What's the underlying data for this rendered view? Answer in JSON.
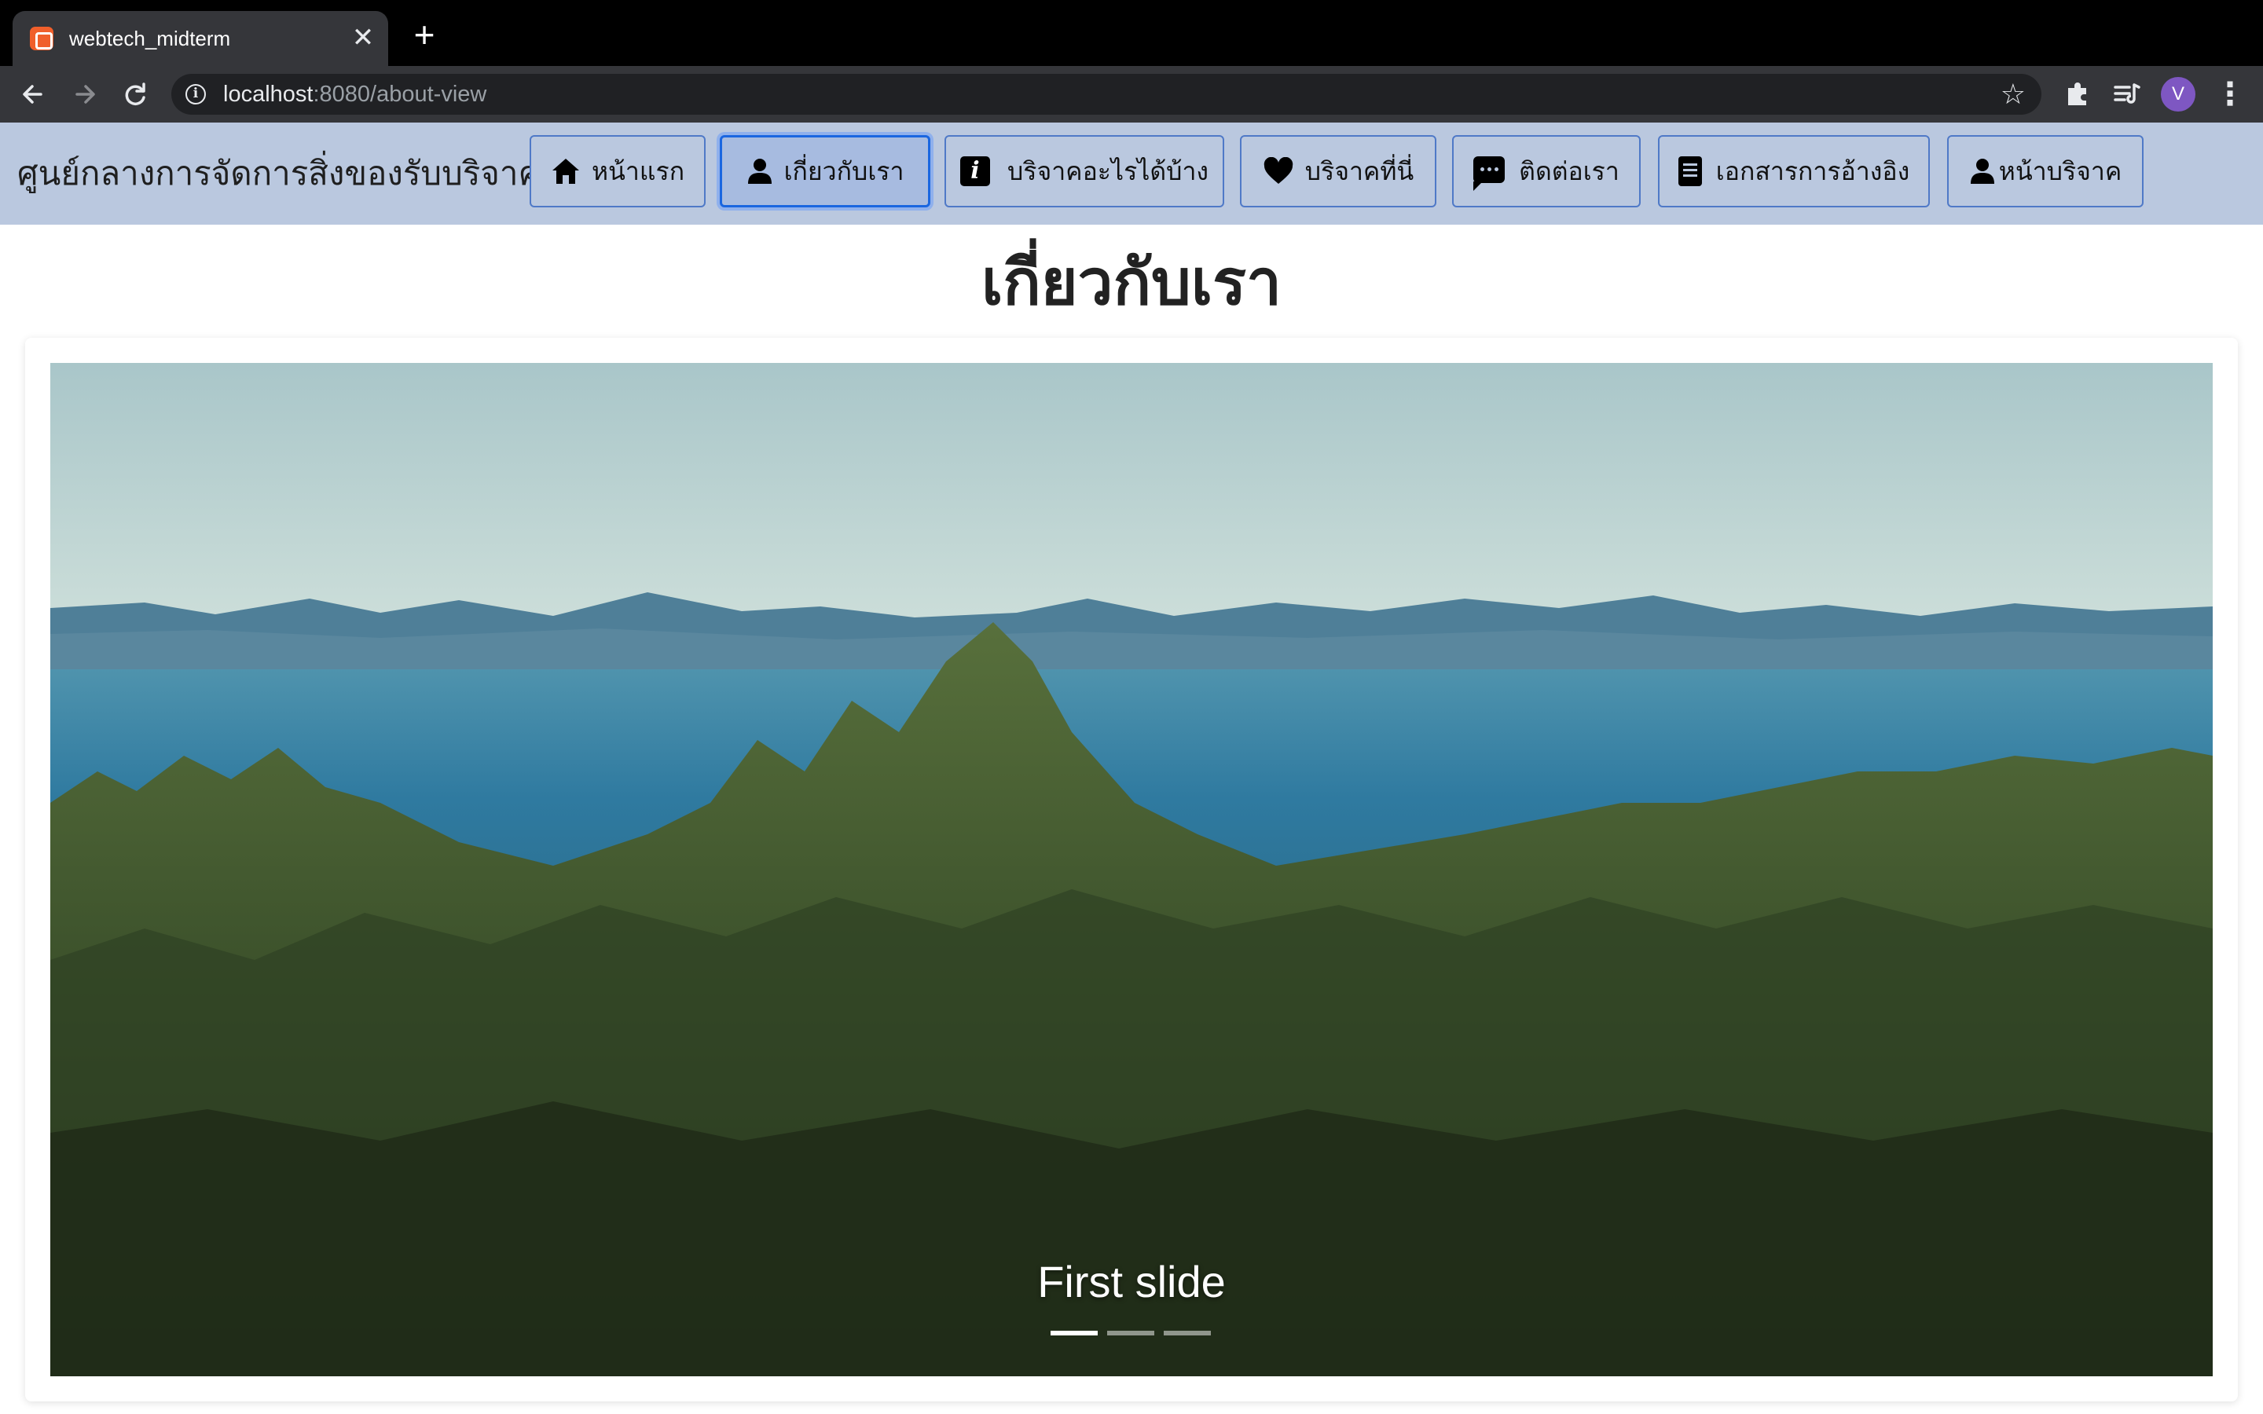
{
  "browser": {
    "tab_title": "webtech_midterm",
    "tab_close": "✕",
    "new_tab": "+",
    "url_host": "localhost",
    "url_rest": ":8080/about-view",
    "profile_initial": "V",
    "icons": [
      "back-icon",
      "forward-icon",
      "reload-icon",
      "info-icon",
      "star-icon",
      "puzzle-icon",
      "media-queue-icon",
      "more-icon"
    ]
  },
  "site": {
    "brand": "ศูนย์กลางการจัดการสิ่งของรับบริจาค",
    "nav": [
      {
        "label": "หน้าแรก",
        "icon": "home-icon",
        "active": false
      },
      {
        "label": "เกี่ยวกับเรา",
        "icon": "person-icon",
        "active": true
      },
      {
        "label": "บริจาคอะไรได้บ้าง",
        "icon": "info-icon",
        "active": false
      },
      {
        "label": "บริจาคที่นี่",
        "icon": "heart-icon",
        "active": false
      },
      {
        "label": "ติดต่อเรา",
        "icon": "chat-icon",
        "active": false
      },
      {
        "label": "เอกสารการอ้างอิง",
        "icon": "document-icon",
        "active": false
      },
      {
        "label": "หน้าบริจาค",
        "icon": "person-icon",
        "active": false
      }
    ]
  },
  "page": {
    "title": "เกี่ยวกับเรา"
  },
  "carousel": {
    "caption": "First slide",
    "slide_count": 3,
    "active_index": 0,
    "image": "forest-and-sea-landscape"
  },
  "colors": {
    "navbar_bg": "#bac8df",
    "button_border": "#4f79c7",
    "active_focus": "#1a66e0",
    "avatar": "#7e57c2"
  }
}
